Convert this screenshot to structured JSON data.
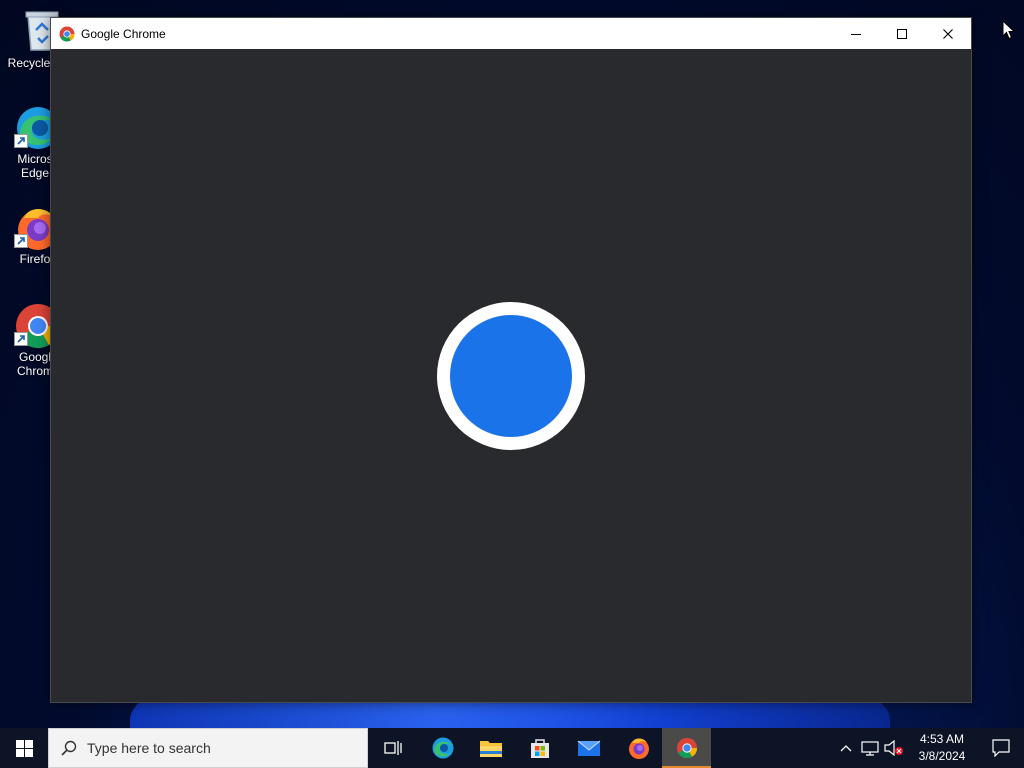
{
  "desktop": {
    "icons": [
      {
        "label": "Recycle",
        "name": "recycle-bin"
      },
      {
        "label": "Microsoft Edge",
        "line1": "Micros",
        "line2": "Edge",
        "name": "edge"
      },
      {
        "label": "Firefox",
        "line1": "Firefo",
        "name": "firefox"
      },
      {
        "label": "Google Chrome",
        "line1": "Googl",
        "line2": "Chrom",
        "name": "chrome"
      }
    ]
  },
  "window": {
    "title": "Google Chrome",
    "controls": {
      "minimize": "minimize",
      "maximize": "maximize",
      "close": "close"
    }
  },
  "taskbar": {
    "search_placeholder": "Type here to search",
    "pinned": [
      "task-view",
      "edge",
      "file-explorer",
      "microsoft-store",
      "mail",
      "firefox",
      "chrome"
    ],
    "active": "chrome",
    "clock": {
      "time": "4:53 AM",
      "date": "3/8/2024"
    }
  },
  "colors": {
    "accent": "#1a73e8",
    "window_bg": "#292a2d",
    "taskbar_active_underline": "#e28a2b"
  }
}
